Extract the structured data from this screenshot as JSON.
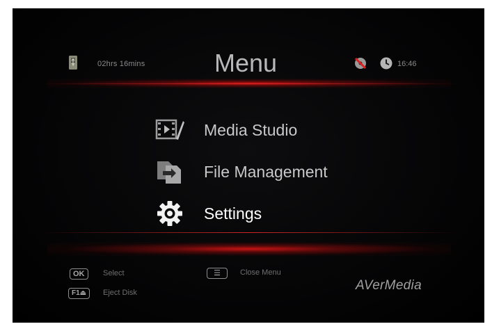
{
  "header": {
    "recording_time": "02hrs 16mins",
    "title": "Menu",
    "clock": "16:46"
  },
  "menu": {
    "items": [
      {
        "label": "Media Studio",
        "icon": "media-studio-icon"
      },
      {
        "label": "File Management",
        "icon": "file-management-icon"
      },
      {
        "label": "Settings",
        "icon": "gear-icon"
      }
    ],
    "selected": "Settings"
  },
  "footer": {
    "hints": [
      {
        "key": "OK",
        "label": "Select"
      },
      {
        "key": "F1⏏",
        "label": "Eject Disk"
      },
      {
        "key": "☰",
        "label": "Close Menu"
      }
    ],
    "brand": "AVerMedia"
  },
  "colors": {
    "background": "#000000",
    "accent_glow": "#d21414",
    "text": "#c8c8c8"
  }
}
